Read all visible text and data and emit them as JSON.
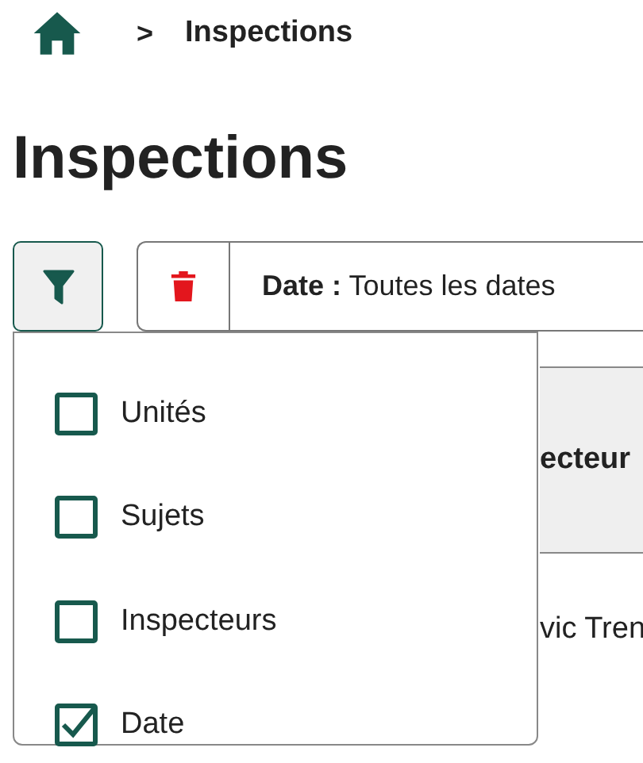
{
  "breadcrumb": {
    "separator": ">",
    "current": "Inspections"
  },
  "title": "Inspections",
  "filter_chip": {
    "label": "Date :",
    "value": "Toutes les dates"
  },
  "filter_menu": {
    "expanded": true,
    "items": [
      {
        "label": "Unités",
        "checked": false
      },
      {
        "label": "Sujets",
        "checked": false
      },
      {
        "label": "Inspecteurs",
        "checked": false
      },
      {
        "label": "Date",
        "checked": true
      }
    ]
  },
  "table": {
    "columns": [
      "ecteur"
    ],
    "rows": [
      [
        "vic Tren"
      ]
    ]
  }
}
